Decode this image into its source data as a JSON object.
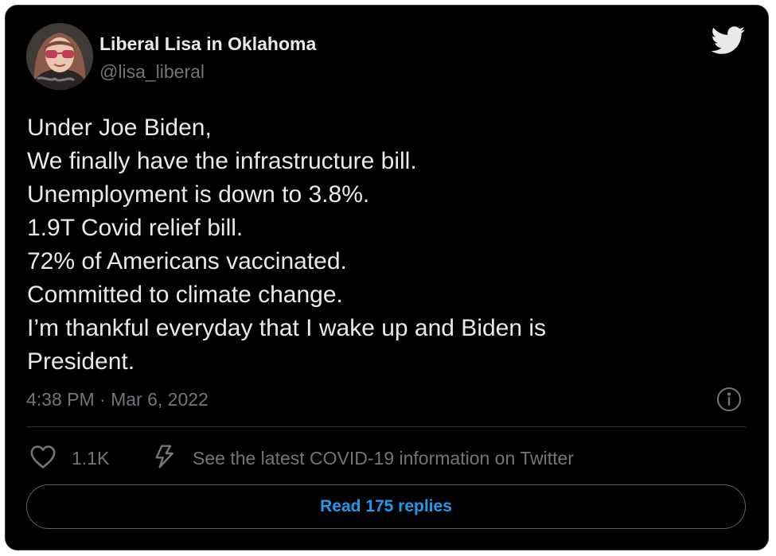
{
  "author": {
    "display_name": "Liberal Lisa in Oklahoma",
    "handle": "@lisa_liberal",
    "avatar_icon": "profile-photo-woman-sunglasses"
  },
  "brand": {
    "icon": "twitter-bird-icon",
    "color": "#e7e9ea"
  },
  "tweet": {
    "lines": [
      "Under Joe Biden,",
      "We finally have the infrastructure bill.",
      "Unemployment is down to 3.8%.",
      "1.9T Covid relief bill.",
      "72% of Americans vaccinated.",
      "Committed to climate change.",
      "I’m thankful everyday that I wake up and Biden is",
      "President."
    ],
    "timestamp": "4:38 PM · Mar 6, 2022"
  },
  "actions": {
    "likes_count": "1.1K",
    "like_icon": "heart-icon",
    "info_icon": "info-icon",
    "covid_icon": "lightning-bolt-icon",
    "covid_label": "See the latest COVID-19 information on Twitter"
  },
  "replies_button": {
    "label": "Read 175 replies"
  },
  "colors": {
    "background": "#000000",
    "primary_text": "#e7e9ea",
    "secondary_text": "#71767b",
    "accent": "#1d9bf0",
    "border": "#2f3336"
  }
}
